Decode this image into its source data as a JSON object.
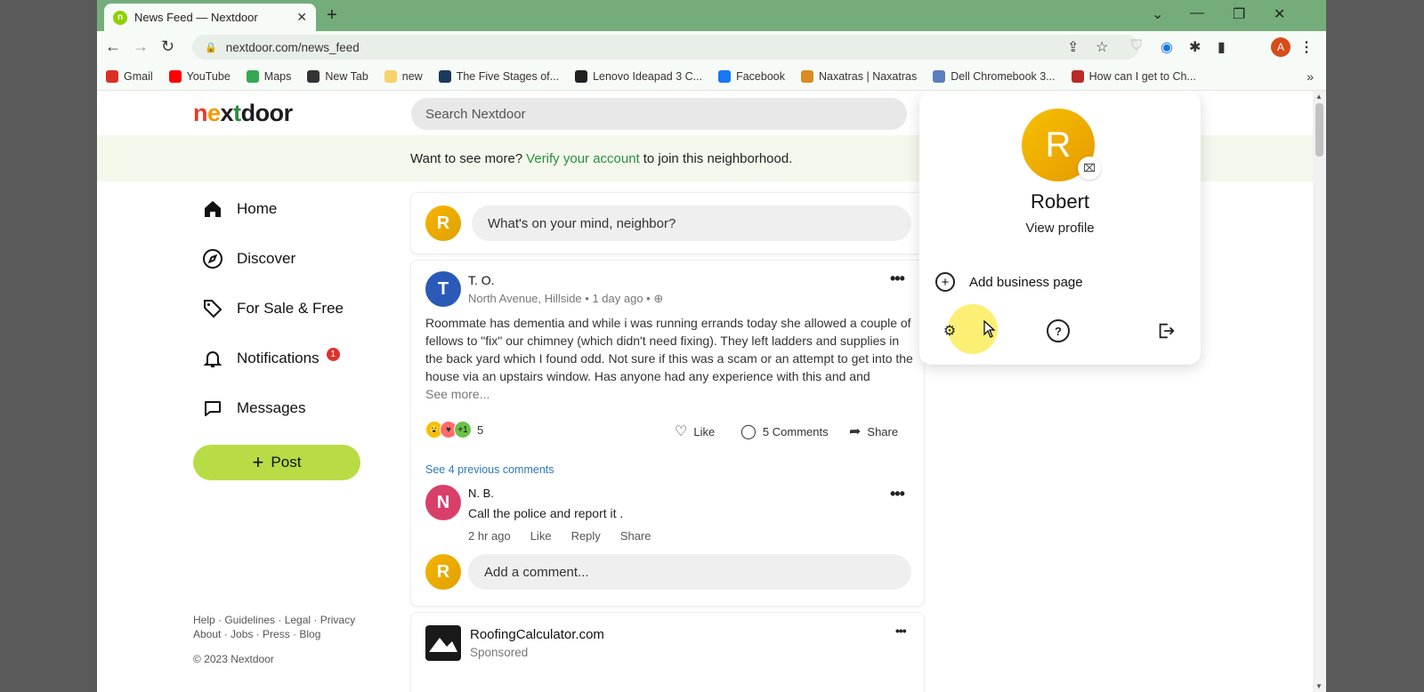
{
  "browser": {
    "tab_title": "News Feed — Nextdoor",
    "tab_favicon": "n",
    "url": "nextdoor.com/news_feed",
    "profile_initial": "A",
    "bookmarks": [
      {
        "label": "Gmail",
        "color": "#d93025"
      },
      {
        "label": "YouTube",
        "color": "#ff0000"
      },
      {
        "label": "Maps",
        "color": "#34a853"
      },
      {
        "label": "New Tab",
        "color": "#333333"
      },
      {
        "label": "new",
        "color": "#f6d36b"
      },
      {
        "label": "The Five Stages of...",
        "color": "#1a3a5f"
      },
      {
        "label": "Lenovo Ideapad 3 C...",
        "color": "#222222"
      },
      {
        "label": "Facebook",
        "color": "#1877f2"
      },
      {
        "label": "Naxatras | Naxatras",
        "color": "#d98c1f"
      },
      {
        "label": "Dell Chromebook 3...",
        "color": "#5a7fc0"
      },
      {
        "label": "How can I get to Ch...",
        "color": "#b92b27"
      }
    ]
  },
  "header": {
    "logo": "nextdoor",
    "search_placeholder": "Search Nextdoor"
  },
  "banner": {
    "prefix": "Want to see more?",
    "link": "Verify your account",
    "suffix": "to join this neighborhood."
  },
  "sidebar": {
    "items": [
      {
        "label": "Home",
        "icon": "home-icon"
      },
      {
        "label": "Discover",
        "icon": "compass-icon"
      },
      {
        "label": "For Sale & Free",
        "icon": "tag-icon"
      },
      {
        "label": "Notifications",
        "icon": "bell-icon",
        "badge": "1"
      },
      {
        "label": "Messages",
        "icon": "chat-bubble-icon"
      }
    ],
    "post_button": "Post",
    "footer_line1": "Help · Guidelines · Legal · Privacy",
    "footer_line2": "About · Jobs · Press · Blog",
    "copyright": "© 2023 Nextdoor"
  },
  "composer": {
    "avatar": "R",
    "placeholder": "What's on your mind, neighbor?"
  },
  "post": {
    "avatar": "T",
    "author": "T. O.",
    "meta": "North Avenue, Hillside • 1 day ago •",
    "body": "Roommate has dementia and while i was running errands today she allowed a couple of fellows to \"fix\" our chimney (which didn't need fixing). They left ladders and supplies in the back yard which I found odd. Not sure if this was a scam or an attempt to get into the house via an upstairs window. Has anyone had any experience with this and and",
    "see_more": "See more...",
    "reaction_count": "5",
    "reaction_extra": "+1",
    "like": "Like",
    "comments": "5 Comments",
    "share": "Share",
    "previous_comments": "See 4 previous comments",
    "comment": {
      "avatar": "N",
      "author": "N. B.",
      "text": "Call the police and report it .",
      "time": "2 hr ago",
      "like": "Like",
      "reply": "Reply",
      "share": "Share"
    },
    "add_comment_avatar": "R",
    "add_comment_placeholder": "Add a comment..."
  },
  "sponsored": {
    "name": "RoofingCalculator.com",
    "label": "Sponsored"
  },
  "profile_menu": {
    "avatar": "R",
    "name": "Robert",
    "view_profile": "View profile",
    "add_business": "Add business page"
  }
}
